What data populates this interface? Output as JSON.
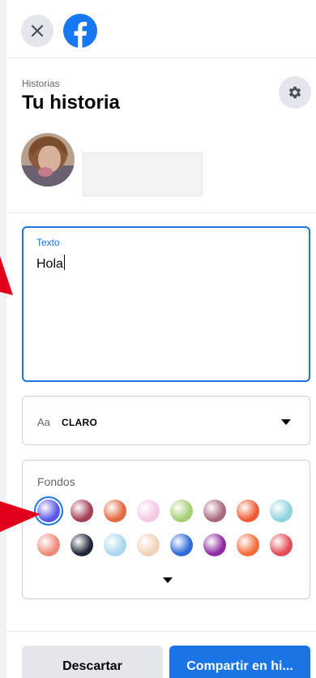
{
  "header": {
    "close_icon": "close-icon",
    "logo_icon": "facebook-logo-icon"
  },
  "section": {
    "subtitle": "Historias",
    "title": "Tu historia",
    "settings_icon": "gear-icon"
  },
  "text_input": {
    "label": "Texto",
    "value": "Hola"
  },
  "font_select": {
    "prefix": "Aa",
    "selected": "CLARO"
  },
  "backgrounds": {
    "label": "Fondos",
    "swatches": [
      {
        "name": "purple-blue",
        "color": "#5a57e8",
        "selected": true
      },
      {
        "name": "maroon-purple",
        "color": "#a33f56"
      },
      {
        "name": "orange-red",
        "color": "#e3683f"
      },
      {
        "name": "pink-pastel",
        "color": "#f4c8e4"
      },
      {
        "name": "yellow-teal",
        "color": "#a5cf74"
      },
      {
        "name": "mauve",
        "color": "#a7677d"
      },
      {
        "name": "music-red",
        "color": "#ef5a35"
      },
      {
        "name": "teal-feather",
        "color": "#8fd3de"
      },
      {
        "name": "heart-red",
        "color": "#ee8a7a"
      },
      {
        "name": "dark-navy",
        "color": "#1f2438"
      },
      {
        "name": "light-blue-pattern",
        "color": "#a9d7ef"
      },
      {
        "name": "beige",
        "color": "#efd2b8"
      },
      {
        "name": "blue",
        "color": "#2e6ad8"
      },
      {
        "name": "purple-magenta",
        "color": "#8e2ba2"
      },
      {
        "name": "orange-yellow",
        "color": "#f56c3a"
      },
      {
        "name": "red",
        "color": "#e24c56"
      }
    ]
  },
  "actions": {
    "discard_label": "Descartar",
    "share_label": "Compartir en hi..."
  },
  "colors": {
    "accent": "#1b74e4",
    "annotation": "#e0001b"
  }
}
